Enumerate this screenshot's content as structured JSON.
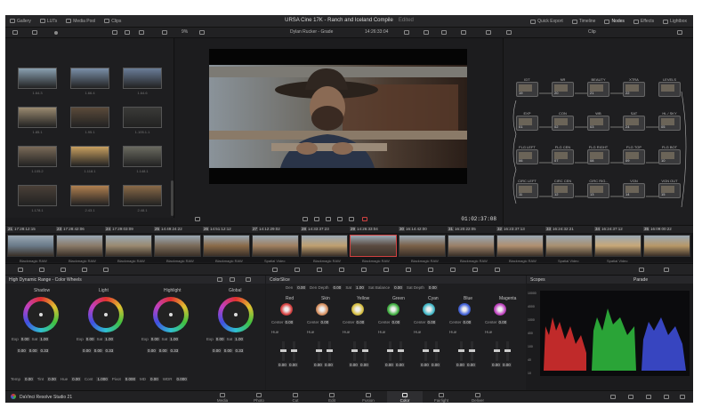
{
  "app": {
    "title": "URSA Cine 17K - Ranch and Iceland Compile",
    "title_status": "Edited",
    "brand": "DaVinci Resolve Studio 21"
  },
  "topbar": {
    "left_items": [
      "Gallery",
      "LUTs",
      "Media Pool",
      "Clips"
    ],
    "right_items": [
      "Quick Export",
      "Timeline",
      "Nodes",
      "Effects",
      "Lightbox"
    ]
  },
  "viewer_bar": {
    "zoom": "9%",
    "grade_name": "Dylan Rucker - Grade",
    "timecode_top": "14:26:33:04",
    "mode": "Clip",
    "timecode": "01:02:37:08"
  },
  "gallery": {
    "stills": [
      "1.64.3",
      "1.66.4",
      "1.64.6",
      "1.85.1",
      "1.95.1",
      "1.105.1.1",
      "1.105.2",
      "1.118.1",
      "1.148.1",
      "1.178.1",
      "2.43.1",
      "2.48.1"
    ]
  },
  "nodes": [
    {
      "label": "IDT",
      "num": "19"
    },
    {
      "label": "NR",
      "num": "20"
    },
    {
      "label": "BEAUTY",
      "num": "21"
    },
    {
      "label": "XTRA",
      "num": "22"
    },
    {
      "label": "LEVELS",
      "num": ""
    },
    {
      "label": "EXP",
      "num": "01"
    },
    {
      "label": "CON",
      "num": "02"
    },
    {
      "label": "WB",
      "num": "03"
    },
    {
      "label": "SAT",
      "num": "24"
    },
    {
      "label": "HL / SKY",
      "num": "05"
    },
    {
      "label": "FLG LEFT",
      "num": "06"
    },
    {
      "label": "FLG CEN",
      "num": "07"
    },
    {
      "label": "FLG RIGHT",
      "num": "08"
    },
    {
      "label": "FLG TOP",
      "num": "09"
    },
    {
      "label": "FLG BOT",
      "num": "10"
    },
    {
      "label": "CIRC LEFT",
      "num": "11"
    },
    {
      "label": "CIRC CEN",
      "num": "12"
    },
    {
      "label": "CIRC RIG..",
      "num": "13"
    },
    {
      "label": "VGN",
      "num": "14"
    },
    {
      "label": "VGN OUT",
      "num": "15"
    }
  ],
  "timeline_clips": [
    {
      "n": "21",
      "tc": "17:28:12:15"
    },
    {
      "n": "23",
      "tc": "17:28:42:06"
    },
    {
      "n": "24",
      "tc": "17:29:03:09"
    },
    {
      "n": "25",
      "tc": "14:49:24:22"
    },
    {
      "n": "26",
      "tc": "14:51:12:12"
    },
    {
      "n": "27",
      "tc": "14:12:29:02"
    },
    {
      "n": "28",
      "tc": "14:33:37:23"
    },
    {
      "n": "29",
      "tc": "14:26:33:04"
    },
    {
      "n": "30",
      "tc": "16:14:42:00"
    },
    {
      "n": "31",
      "tc": "16:20:22:05"
    },
    {
      "n": "32",
      "tc": "16:23:37:13"
    },
    {
      "n": "33",
      "tc": "16:24:32:21"
    },
    {
      "n": "34",
      "tc": "16:24:37:12"
    },
    {
      "n": "35",
      "tc": "16:09:00:22"
    }
  ],
  "clip_codec_labels": [
    "Blackmagic RAW",
    "Blackmagic RAW",
    "Blackmagic RAW",
    "Blackmagic RAW",
    "Blackmagic RAW",
    "Spatial Video",
    "Blackmagic RAW",
    "Blackmagic RAW",
    "Blackmagic RAW",
    "Blackmagic RAW",
    "Blackmagic RAW",
    "Spatial Video",
    "Spatial Video"
  ],
  "color_wheels": {
    "title": "High Dynamic Range - Color Wheels",
    "wheels": [
      "Shadow",
      "Light",
      "Highlight",
      "Global"
    ],
    "exp_row": [
      "Exp",
      "0.00",
      "Sat",
      "1.00"
    ],
    "xy_row": [
      "0.00",
      "0.00",
      "0.33"
    ],
    "bottom": [
      "Temp",
      "0.00",
      "Tint",
      "0.00",
      "Hue",
      "0.00",
      "Cont",
      "1.000",
      "Pivot",
      "0.000",
      "MD",
      "0.00",
      "WDR",
      "0.000"
    ]
  },
  "colorslice": {
    "title": "ColorSlice",
    "top_params": [
      "Den",
      "0.00",
      "Den Depth",
      "0.00",
      "Sat",
      "1.00",
      "Sat Balance",
      "0.00",
      "Sat Depth",
      "0.00"
    ],
    "slices": [
      {
        "name": "Red",
        "color": "#d84040"
      },
      {
        "name": "Skin",
        "color": "#d89060"
      },
      {
        "name": "Yellow",
        "color": "#d8c040"
      },
      {
        "name": "Green",
        "color": "#40b040"
      },
      {
        "name": "Cyan",
        "color": "#40b8c8"
      },
      {
        "name": "Blue",
        "color": "#4060d8"
      },
      {
        "name": "Magenta",
        "color": "#c040c0"
      }
    ],
    "center_label": "Center",
    "center_value": "0.00",
    "hue_label": "Hue",
    "slider_value": "0.00"
  },
  "scopes": {
    "title": "Scopes",
    "mode": "Parade",
    "scale": [
      "10000",
      "4000",
      "1000",
      "400",
      "100",
      "40",
      "10"
    ]
  },
  "pages": [
    "Media",
    "Photo",
    "Cut",
    "Edit",
    "Fusion",
    "Color",
    "Fairlight",
    "Deliver"
  ],
  "active_page": "Color"
}
